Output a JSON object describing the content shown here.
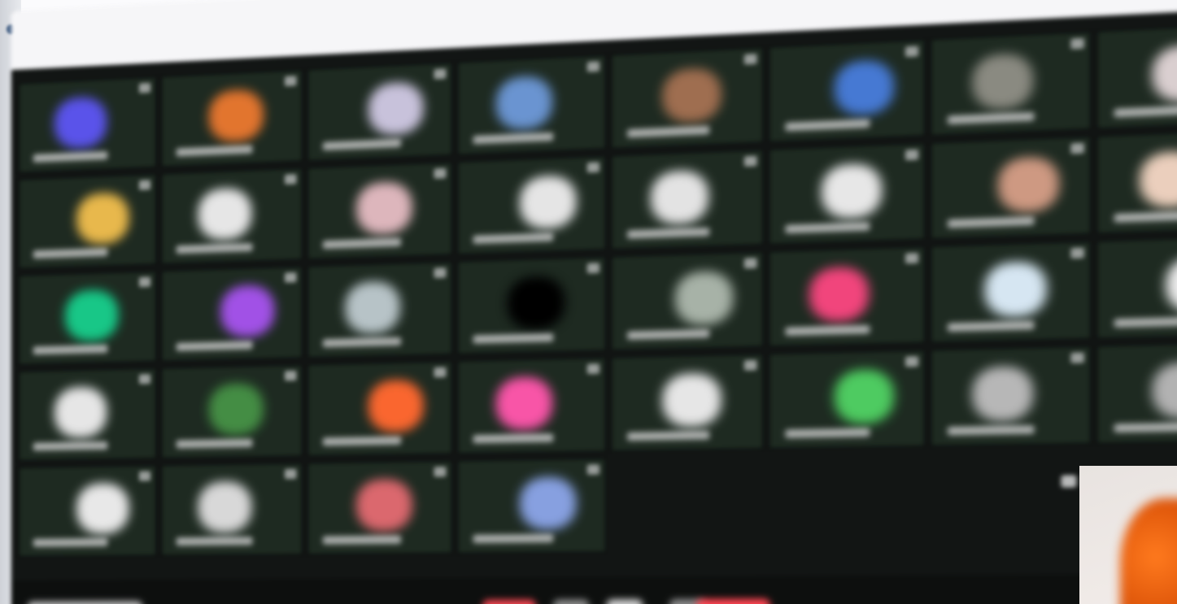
{
  "window": {
    "title": ""
  },
  "meeting": {
    "layout": "gallery-view",
    "participant_tiles": [
      {
        "glow": "#5b55d8"
      },
      {
        "glow": "#d6773a"
      },
      {
        "glow": "#c8c2d8"
      },
      {
        "glow": "#6f93c8"
      },
      {
        "glow": "#9a6f55"
      },
      {
        "glow": "#4c78c7"
      },
      {
        "glow": "#8a8a82"
      },
      {
        "glow": "#d9cfd0"
      },
      {
        "glow": "#e2b85a"
      },
      {
        "glow": "#e6e6e6"
      },
      {
        "glow": "#d9b7bc"
      },
      {
        "glow": "#e5e5e5"
      },
      {
        "glow": "#e3e3e3"
      },
      {
        "glow": "#e7e7e7"
      },
      {
        "glow": "#c89a86"
      },
      {
        "glow": "#e8d0c0"
      },
      {
        "glow": "#29c28a"
      },
      {
        "glow": "#9a55d6"
      },
      {
        "glow": "#b8c3c6"
      },
      {
        "glow": "#000000"
      },
      {
        "glow": "#a8b2a8"
      },
      {
        "glow": "#e04a7a"
      },
      {
        "glow": "#d8e6f0"
      },
      {
        "glow": "#eeeeee"
      },
      {
        "glow": "#e6e6e6"
      },
      {
        "glow": "#4b8a4b"
      },
      {
        "glow": "#ea6a3a"
      },
      {
        "glow": "#e85aa2"
      },
      {
        "glow": "#e6e6e6"
      },
      {
        "glow": "#5ac76a"
      },
      {
        "glow": "#b7b7b7"
      },
      {
        "glow": "#b2b2b2"
      },
      {
        "glow": "#e8e8e8"
      },
      {
        "glow": "#d8d8d8"
      },
      {
        "glow": "#cf6b70"
      },
      {
        "glow": "#8aa0d8"
      }
    ]
  },
  "colors": {
    "screen_bg": "#121514",
    "tile_bg": "#1f2a22",
    "window_top": "#f6f6f8",
    "accent_orange": "#ff7a1e"
  }
}
